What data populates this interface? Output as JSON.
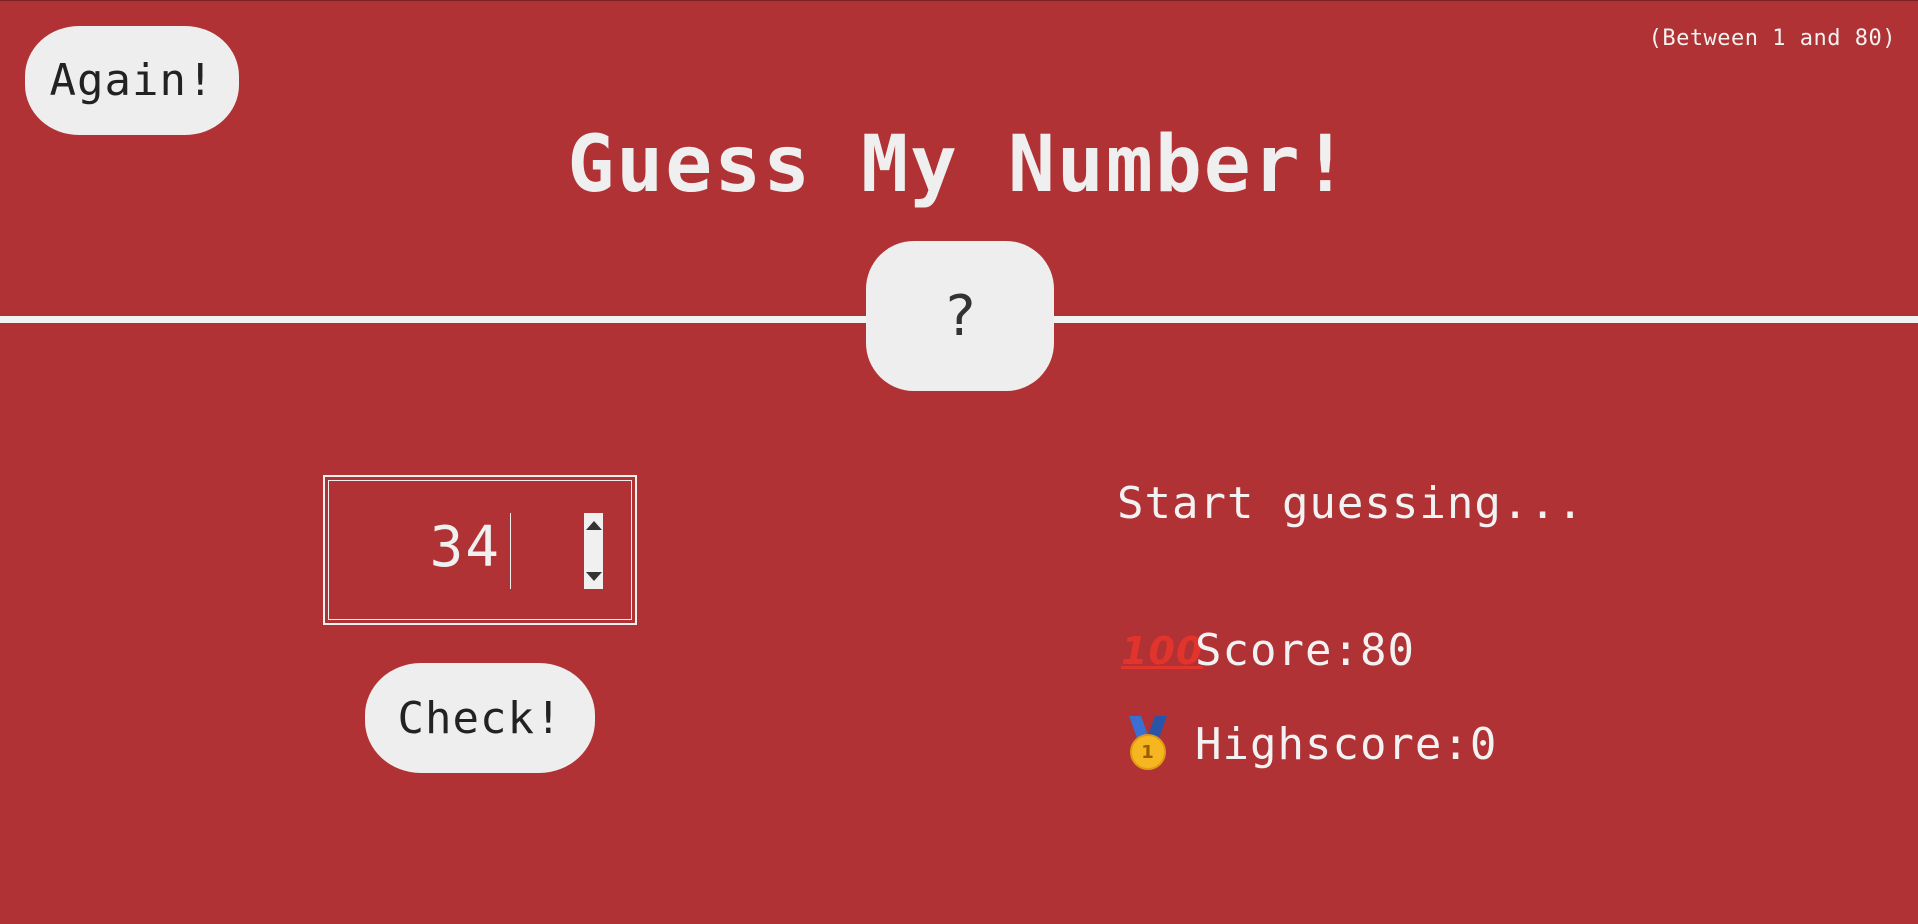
{
  "header": {
    "again_label": "Again!",
    "range_hint": "(Between 1 and 80)",
    "title": "Guess My Number!",
    "secret_number": "?"
  },
  "main": {
    "guess_input": {
      "value": "34"
    },
    "check_label": "Check!",
    "message": "Start guessing...",
    "score": {
      "icon": "hundred-points-icon",
      "label": "Score: ",
      "value": "80"
    },
    "highscore": {
      "icon": "first-place-medal-icon",
      "label": "Highscore: ",
      "value": "0",
      "medal_number": "1"
    }
  },
  "colors": {
    "background": "#b03234",
    "foreground": "#eeeeee"
  }
}
